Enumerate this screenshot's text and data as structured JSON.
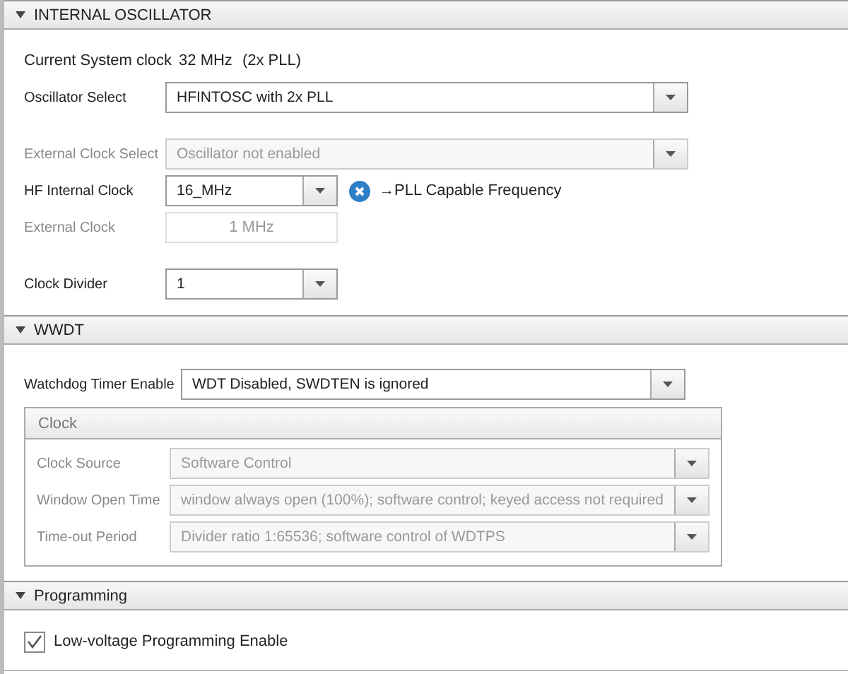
{
  "sections": [
    {
      "title": "INTERNAL OSCILLATOR",
      "expanded": true,
      "kind": "oscillator",
      "current_clock": {
        "label": "Current System clock",
        "value": "32 MHz",
        "note": "(2x PLL)"
      },
      "fields": [
        {
          "kind": "select",
          "label": "Oscillator Select",
          "value": "HFINTOSC with 2x PLL",
          "disabled": false
        },
        {
          "kind": "select",
          "label": "External Clock Select",
          "value": "Oscillator not enabled",
          "disabled": true
        },
        {
          "kind": "shortselect",
          "label": "HF Internal Clock",
          "value": "16_MHz",
          "disabled": false,
          "message": "→PLL Capable Frequency"
        },
        {
          "kind": "textbox",
          "label": "External Clock",
          "value": "1 MHz",
          "disabled": true
        },
        {
          "kind": "shortselect",
          "label": "Clock Divider",
          "value": "1",
          "disabled": false
        }
      ]
    },
    {
      "title": "WWDT",
      "expanded": true,
      "kind": "wwdt",
      "watchdog": {
        "label": "Watchdog Timer Enable",
        "value": "WDT Disabled, SWDTEN is ignored",
        "disabled": false
      },
      "group": {
        "title": "Clock",
        "fields": [
          {
            "label": "Clock Source",
            "value": "Software Control",
            "disabled": true
          },
          {
            "label": "Window Open Time",
            "value": "window always open (100%); software control; keyed access not required",
            "disabled": true
          },
          {
            "label": "Time-out Period",
            "value": "Divider ratio 1:65536; software control of WDTPS",
            "disabled": true
          }
        ]
      }
    },
    {
      "title": "Programming",
      "expanded": true,
      "kind": "programming",
      "checkbox": {
        "label": "Low-voltage Programming Enable",
        "checked": true
      }
    }
  ]
}
